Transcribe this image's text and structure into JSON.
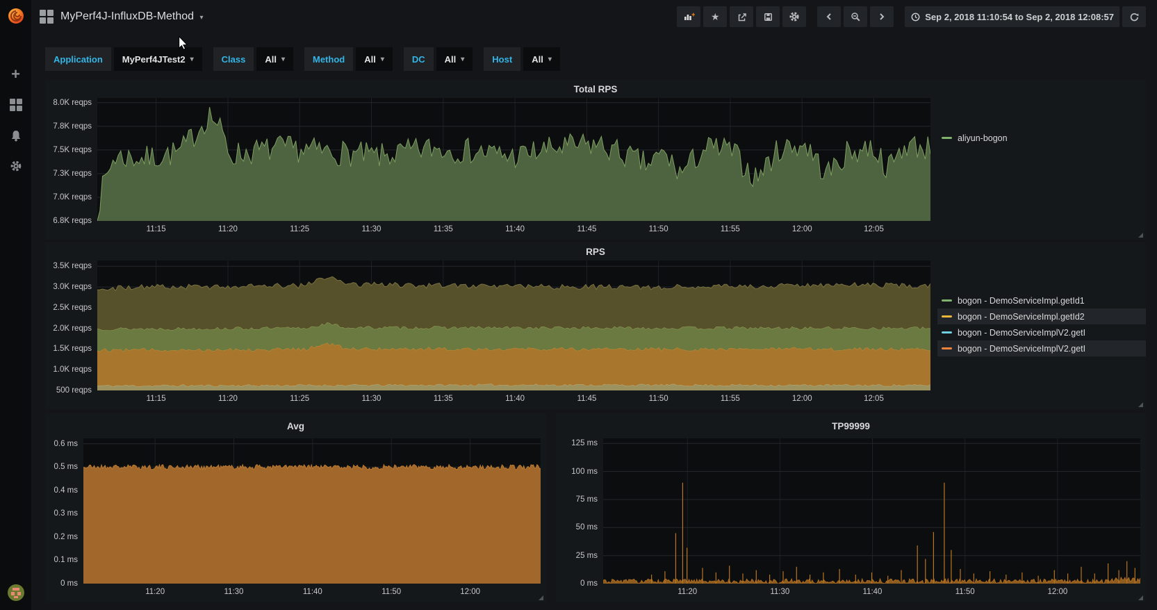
{
  "navbar": {
    "title": "MyPerf4J-InfluxDB-Method",
    "time_range": "Sep 2, 2018 11:10:54 to Sep 2, 2018 12:08:57",
    "icons": [
      "bar-chart-plus-icon",
      "star-icon",
      "share-icon",
      "save-icon",
      "gear-icon",
      "chevron-left-icon",
      "zoom-out-icon",
      "chevron-right-icon",
      "clock-icon",
      "refresh-icon"
    ]
  },
  "sidebar": {
    "icons": [
      "grafana-logo",
      "plus-icon",
      "dashboards-grid-icon",
      "alerting-bell-icon",
      "configuration-gear-icon",
      "user-avatar"
    ]
  },
  "filters": [
    {
      "label": "Application",
      "value": "MyPerf4JTest2"
    },
    {
      "label": "Class",
      "value": "All"
    },
    {
      "label": "Method",
      "value": "All"
    },
    {
      "label": "DC",
      "value": "All"
    },
    {
      "label": "Host",
      "value": "All"
    }
  ],
  "colors": {
    "accent_cyan": "#33b5e5",
    "legend_green": "#7eb26d",
    "legend_yellow": "#eab839",
    "legend_cyan": "#6ed0e0",
    "legend_orange": "#ef843c"
  },
  "charts": [
    {
      "title": "Total RPS",
      "type": "area",
      "unit": "reqps",
      "ylim": [
        6750,
        8050
      ],
      "yticks": [
        {
          "v": 6750,
          "label": "6.8K reqps"
        },
        {
          "v": 7000,
          "label": "7.0K reqps"
        },
        {
          "v": 7250,
          "label": "7.3K reqps"
        },
        {
          "v": 7500,
          "label": "7.5K reqps"
        },
        {
          "v": 7750,
          "label": "7.8K reqps"
        },
        {
          "v": 8000,
          "label": "8.0K reqps"
        }
      ],
      "xticks": [
        {
          "f": 0.0706,
          "label": "11:15"
        },
        {
          "f": 0.1568,
          "label": "11:20"
        },
        {
          "f": 0.2429,
          "label": "11:25"
        },
        {
          "f": 0.329,
          "label": "11:30"
        },
        {
          "f": 0.4152,
          "label": "11:35"
        },
        {
          "f": 0.5013,
          "label": "11:40"
        },
        {
          "f": 0.5875,
          "label": "11:45"
        },
        {
          "f": 0.6736,
          "label": "11:50"
        },
        {
          "f": 0.7597,
          "label": "11:55"
        },
        {
          "f": 0.8459,
          "label": "12:00"
        },
        {
          "f": 0.932,
          "label": "12:05"
        }
      ],
      "legend": [
        {
          "label": "aliyun-bogon",
          "color": "#7eb26d"
        }
      ],
      "layers": [
        {
          "fill": "#4e6440",
          "stroke": "#7e9e61",
          "jitter": 140,
          "samples": 320,
          "seed": 7,
          "base": [
            [
              0,
              6870
            ],
            [
              0.008,
              7150
            ],
            [
              0.02,
              7430
            ],
            [
              0.06,
              7410
            ],
            [
              0.1,
              7480
            ],
            [
              0.135,
              7880
            ],
            [
              0.145,
              7760
            ],
            [
              0.16,
              7450
            ],
            [
              0.22,
              7520
            ],
            [
              0.28,
              7480
            ],
            [
              0.34,
              7430
            ],
            [
              0.4,
              7520
            ],
            [
              0.46,
              7480
            ],
            [
              0.5,
              7430
            ],
            [
              0.55,
              7520
            ],
            [
              0.6,
              7560
            ],
            [
              0.63,
              7460
            ],
            [
              0.66,
              7340
            ],
            [
              0.68,
              7460
            ],
            [
              0.7,
              7250
            ],
            [
              0.73,
              7520
            ],
            [
              0.76,
              7500
            ],
            [
              0.79,
              7200
            ],
            [
              0.82,
              7520
            ],
            [
              0.85,
              7560
            ],
            [
              0.875,
              7240
            ],
            [
              0.9,
              7460
            ],
            [
              0.93,
              7540
            ],
            [
              0.95,
              7300
            ],
            [
              0.97,
              7560
            ],
            [
              1,
              7520
            ]
          ]
        }
      ]
    },
    {
      "title": "RPS",
      "type": "stacked-area",
      "unit": "reqps",
      "ylim": [
        500,
        3640
      ],
      "yticks": [
        {
          "v": 500,
          "label": "500 reqps"
        },
        {
          "v": 1000,
          "label": "1.0K reqps"
        },
        {
          "v": 1500,
          "label": "1.5K reqps"
        },
        {
          "v": 2000,
          "label": "2.0K reqps"
        },
        {
          "v": 2500,
          "label": "2.5K reqps"
        },
        {
          "v": 3000,
          "label": "3.0K reqps"
        },
        {
          "v": 3500,
          "label": "3.5K reqps"
        }
      ],
      "xticks": [
        {
          "f": 0.0706,
          "label": "11:15"
        },
        {
          "f": 0.1568,
          "label": "11:20"
        },
        {
          "f": 0.2429,
          "label": "11:25"
        },
        {
          "f": 0.329,
          "label": "11:30"
        },
        {
          "f": 0.4152,
          "label": "11:35"
        },
        {
          "f": 0.5013,
          "label": "11:40"
        },
        {
          "f": 0.5875,
          "label": "11:45"
        },
        {
          "f": 0.6736,
          "label": "11:50"
        },
        {
          "f": 0.7597,
          "label": "11:55"
        },
        {
          "f": 0.8459,
          "label": "12:00"
        },
        {
          "f": 0.932,
          "label": "12:05"
        }
      ],
      "legend": [
        {
          "label": "bogon - DemoServiceImpl.getId1",
          "color": "#7eb26d"
        },
        {
          "label": "bogon - DemoServiceImpl.getId2",
          "color": "#eab839"
        },
        {
          "label": "bogon - DemoServiceImplV2.getI",
          "color": "#6ed0e0"
        },
        {
          "label": "bogon - DemoServiceImplV2.getI",
          "color": "#ef843c"
        }
      ],
      "layers": [
        {
          "fill": "#9b9260",
          "stroke": "#b9b07b",
          "jitter": 28,
          "samples": 320,
          "seed": 11,
          "base": [
            [
              0,
              615
            ],
            [
              0.5,
              635
            ],
            [
              1,
              625
            ]
          ]
        },
        {
          "fill": "#a9762e",
          "stroke": "#c48d35",
          "jitter": 45,
          "samples": 320,
          "seed": 12,
          "base": [
            [
              0,
              1480
            ],
            [
              0.25,
              1500
            ],
            [
              0.275,
              1640
            ],
            [
              0.3,
              1515
            ],
            [
              0.65,
              1500
            ],
            [
              1,
              1505
            ]
          ]
        },
        {
          "fill": "#6b7a41",
          "stroke": "#93a058",
          "jitter": 40,
          "samples": 320,
          "seed": 13,
          "base": [
            [
              0,
              1990
            ],
            [
              0.25,
              2005
            ],
            [
              0.275,
              2120
            ],
            [
              0.3,
              2020
            ],
            [
              1,
              2005
            ]
          ]
        },
        {
          "fill": "#57512b",
          "stroke": "#7b7140",
          "jitter": 65,
          "samples": 320,
          "seed": 14,
          "base": [
            [
              0,
              2940
            ],
            [
              0.04,
              3000
            ],
            [
              0.25,
              3030
            ],
            [
              0.275,
              3240
            ],
            [
              0.31,
              3060
            ],
            [
              0.5,
              3010
            ],
            [
              0.75,
              3000
            ],
            [
              0.88,
              3050
            ],
            [
              1,
              3030
            ]
          ]
        }
      ]
    },
    {
      "title": "Avg",
      "type": "area",
      "unit": "ms",
      "ylim": [
        0,
        0.623
      ],
      "yticks": [
        {
          "v": 0,
          "label": "0 ms"
        },
        {
          "v": 0.1,
          "label": "0.1 ms"
        },
        {
          "v": 0.2,
          "label": "0.2 ms"
        },
        {
          "v": 0.3,
          "label": "0.3 ms"
        },
        {
          "v": 0.4,
          "label": "0.4 ms"
        },
        {
          "v": 0.5,
          "label": "0.5 ms"
        },
        {
          "v": 0.6,
          "label": "0.6 ms"
        }
      ],
      "xticks": [
        {
          "f": 0.1568,
          "label": "11:20"
        },
        {
          "f": 0.329,
          "label": "11:30"
        },
        {
          "f": 0.5013,
          "label": "11:40"
        },
        {
          "f": 0.6736,
          "label": "11:50"
        },
        {
          "f": 0.8459,
          "label": "12:00"
        }
      ],
      "legend": [],
      "layers": [
        {
          "fill": "#a2672b",
          "stroke": "#bb7a2e",
          "jitter": 0.011,
          "samples": 380,
          "seed": 21,
          "base": [
            [
              0,
              0.5
            ],
            [
              1,
              0.5
            ]
          ]
        }
      ]
    },
    {
      "title": "TP99999",
      "type": "area",
      "unit": "ms",
      "ylim": [
        0,
        129.5
      ],
      "yticks": [
        {
          "v": 0,
          "label": "0 ms"
        },
        {
          "v": 25,
          "label": "25 ms"
        },
        {
          "v": 50,
          "label": "50 ms"
        },
        {
          "v": 75,
          "label": "75 ms"
        },
        {
          "v": 100,
          "label": "100 ms"
        },
        {
          "v": 125,
          "label": "125 ms"
        }
      ],
      "xticks": [
        {
          "f": 0.1568,
          "label": "11:20"
        },
        {
          "f": 0.329,
          "label": "11:30"
        },
        {
          "f": 0.5013,
          "label": "11:40"
        },
        {
          "f": 0.6736,
          "label": "11:50"
        },
        {
          "f": 0.8459,
          "label": "12:00"
        }
      ],
      "legend": [],
      "spike_color": "#b9751f",
      "spikes": [
        [
          0.09,
          8
        ],
        [
          0.115,
          11
        ],
        [
          0.135,
          45
        ],
        [
          0.148,
          90
        ],
        [
          0.156,
          32
        ],
        [
          0.185,
          14
        ],
        [
          0.21,
          10
        ],
        [
          0.235,
          16
        ],
        [
          0.26,
          9
        ],
        [
          0.285,
          12
        ],
        [
          0.31,
          8
        ],
        [
          0.335,
          11
        ],
        [
          0.36,
          15
        ],
        [
          0.385,
          8
        ],
        [
          0.41,
          10
        ],
        [
          0.44,
          13
        ],
        [
          0.47,
          8
        ],
        [
          0.5,
          10
        ],
        [
          0.53,
          7
        ],
        [
          0.555,
          12
        ],
        [
          0.585,
          34
        ],
        [
          0.6,
          22
        ],
        [
          0.615,
          46
        ],
        [
          0.635,
          90
        ],
        [
          0.648,
          30
        ],
        [
          0.665,
          13
        ],
        [
          0.69,
          9
        ],
        [
          0.72,
          11
        ],
        [
          0.75,
          8
        ],
        [
          0.78,
          10
        ],
        [
          0.81,
          7
        ],
        [
          0.84,
          12
        ],
        [
          0.865,
          9
        ],
        [
          0.89,
          15
        ],
        [
          0.915,
          9
        ],
        [
          0.94,
          18
        ],
        [
          0.96,
          12
        ],
        [
          0.975,
          20
        ],
        [
          0.99,
          14
        ]
      ],
      "layers": [
        {
          "fill": "#8f5c20",
          "stroke": "#a96a1e",
          "jitter": 2.2,
          "samples": 420,
          "seed": 31,
          "base": [
            [
              0,
              2
            ],
            [
              0.93,
              2.2
            ],
            [
              0.96,
              3.5
            ],
            [
              1,
              3
            ]
          ]
        }
      ]
    }
  ]
}
